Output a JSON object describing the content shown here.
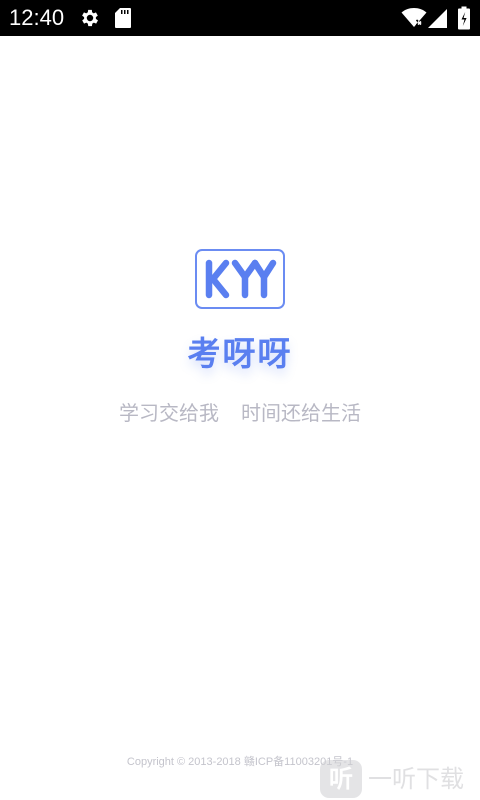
{
  "status_bar": {
    "time": "12:40",
    "icons": [
      "gear-icon",
      "sdcard-icon",
      "wifi-icon",
      "signal-icon",
      "battery-icon"
    ]
  },
  "splash": {
    "logo_text": "KYY",
    "app_name": "考呀呀",
    "slogan_part1": "学习交给我",
    "slogan_part2": "时间还给生活",
    "copyright": "Copyright © 2013-2018 赣ICP备11003201号-1"
  },
  "watermark": {
    "badge": "听",
    "text": "一听下载"
  },
  "colors": {
    "brand": "#5a7ff0",
    "slogan": "#b8b8c4",
    "status_bar_bg": "#000000"
  }
}
